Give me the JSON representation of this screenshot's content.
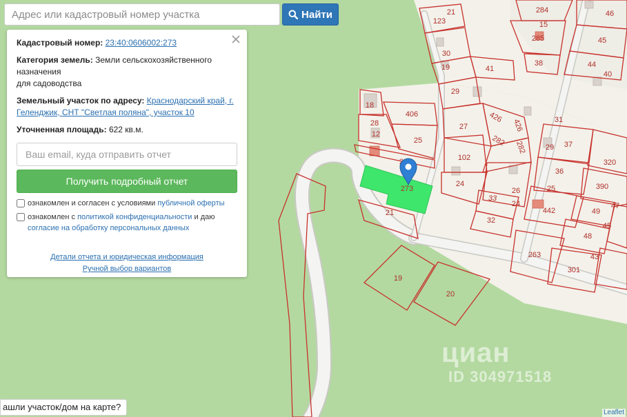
{
  "search": {
    "placeholder": "Адрес или кадастровый номер участка",
    "button_label": "Найти"
  },
  "panel": {
    "cadastral_label": "Кадастровый номер:",
    "cadastral_value": "23:40:0606002:273",
    "category_label": "Категория земель:",
    "category_value": "Земли сельскохозяйственного назначения",
    "category_use": "для садоводства",
    "address_label": "Земельный участок по адресу:",
    "address_value": "Краснодарский край, г. Геленджик, СНТ \"Светлая поляна\", участок 10",
    "area_label": "Уточненная площадь:",
    "area_value": "622 кв.м.",
    "email_placeholder": "Ваш email, куда отправить отчет",
    "report_button": "Получить подробный отчет",
    "consent1_text": "ознакомлен и согласен с условиями",
    "consent1_link": "публичной оферты",
    "consent2_text": "ознакомлен с",
    "consent2_link": "политикой конфиденциальности",
    "consent2_and": "и даю",
    "consent2_link2": "согласие на обработку персональных данных",
    "details_link": "Детали отчета и юридическая информация",
    "manual_link": "Ручной выбор вариантов"
  },
  "bottom_note": "ашли участок/дом на карте?",
  "watermark": {
    "brand": "циан",
    "id": "ID 304971518"
  },
  "attribution": "Leaflet",
  "map": {
    "colors": {
      "background": "#b3d9a0",
      "plot_border": "#c8312c",
      "selected_plot": "#3ee66b",
      "marker": "#2f7fd4"
    },
    "plot_labels": [
      "21",
      "123",
      "30",
      "19",
      "41",
      "284",
      "15",
      "285",
      "38",
      "46",
      "45",
      "44",
      "40",
      "29",
      "18",
      "406",
      "28",
      "12",
      "25",
      "426",
      "426",
      "27",
      "282",
      "282",
      "31",
      "37",
      "29",
      "102",
      "23",
      "273",
      "24",
      "26",
      "36",
      "320",
      "25",
      "390",
      "24",
      "33",
      "32",
      "442",
      "49",
      "47",
      "21",
      "45",
      "48",
      "263",
      "43",
      "301",
      "19",
      "20"
    ]
  }
}
